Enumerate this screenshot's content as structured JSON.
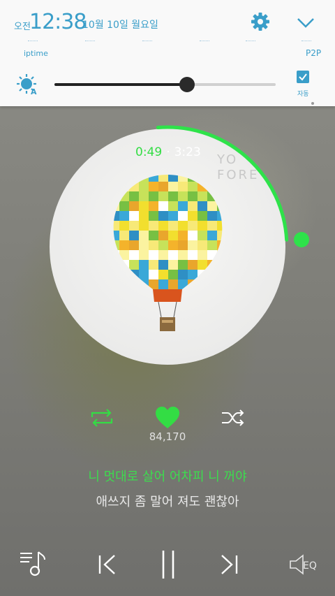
{
  "status": {
    "ampm": "오전",
    "time": "12:38",
    "date": "10월 10일 월요일"
  },
  "quick_settings": {
    "labels": [
      "iptime",
      "P2P"
    ],
    "auto_brightness_label": "자동",
    "brightness": 0.6
  },
  "player": {
    "elapsed": "0:49",
    "separator": "·",
    "total": "3:23",
    "progress": 0.241,
    "like_count": "84,170",
    "lyric_current": "니 멋대로 살어 어차피 니 꺼야",
    "lyric_next": "애쓰지 좀 말어 져도 괜찮아",
    "eq_label": "EQ"
  },
  "colors": {
    "accent_blue": "#3a9ec9",
    "accent_green": "#33dd44",
    "control_white": "#ffffff"
  },
  "icons": [
    "gear-icon",
    "chevron-down-icon",
    "auto-brightness-icon",
    "checkbox-checked-icon",
    "repeat-icon",
    "heart-icon",
    "shuffle-icon",
    "playlist-icon",
    "previous-icon",
    "pause-icon",
    "next-icon",
    "eq-icon"
  ]
}
